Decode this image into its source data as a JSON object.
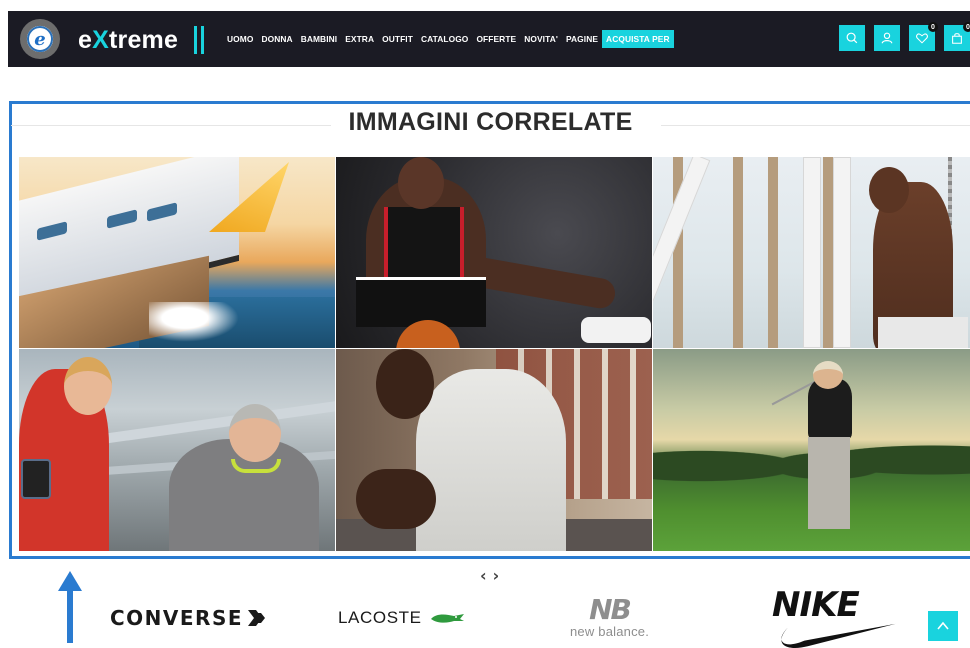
{
  "header": {
    "logo_text_pre": "e",
    "logo_text_x": "X",
    "logo_text_post": "treme",
    "logo_badge_letter": "e",
    "nav": [
      {
        "label": "UOMO",
        "highlight": false
      },
      {
        "label": "DONNA",
        "highlight": false
      },
      {
        "label": "BAMBINI",
        "highlight": false
      },
      {
        "label": "EXTRA",
        "highlight": false
      },
      {
        "label": "OUTFIT",
        "highlight": false
      },
      {
        "label": "CATALOGO",
        "highlight": false
      },
      {
        "label": "OFFERTE",
        "highlight": false
      },
      {
        "label": "NOVITA'",
        "highlight": false
      },
      {
        "label": "PAGINE",
        "highlight": false
      },
      {
        "label": "ACQUISTA PER",
        "highlight": true
      }
    ],
    "icons": [
      {
        "name": "search-icon"
      },
      {
        "name": "user-icon"
      },
      {
        "name": "heart-icon",
        "badge": "0"
      },
      {
        "name": "cart-icon",
        "badge": "0"
      }
    ],
    "accent_color": "#19d3de",
    "bg_color": "#1b1b24"
  },
  "gallery": {
    "title": "IMMAGINI CORRELATE",
    "images": [
      {
        "name": "sailing-boat-image"
      },
      {
        "name": "basketball-player-image"
      },
      {
        "name": "gym-rings-athlete-image"
      },
      {
        "name": "runners-conversation-image"
      },
      {
        "name": "hoodie-runner-image"
      },
      {
        "name": "golfer-image"
      }
    ]
  },
  "carousel": {
    "prev": "‹",
    "next": "›"
  },
  "brands": [
    {
      "name": "converse",
      "label": "CONVERSE"
    },
    {
      "name": "lacoste",
      "label": "LACOSTE"
    },
    {
      "name": "new-balance",
      "mark": "NB",
      "label": "new balance."
    },
    {
      "name": "nike",
      "label": "NIKE"
    }
  ]
}
